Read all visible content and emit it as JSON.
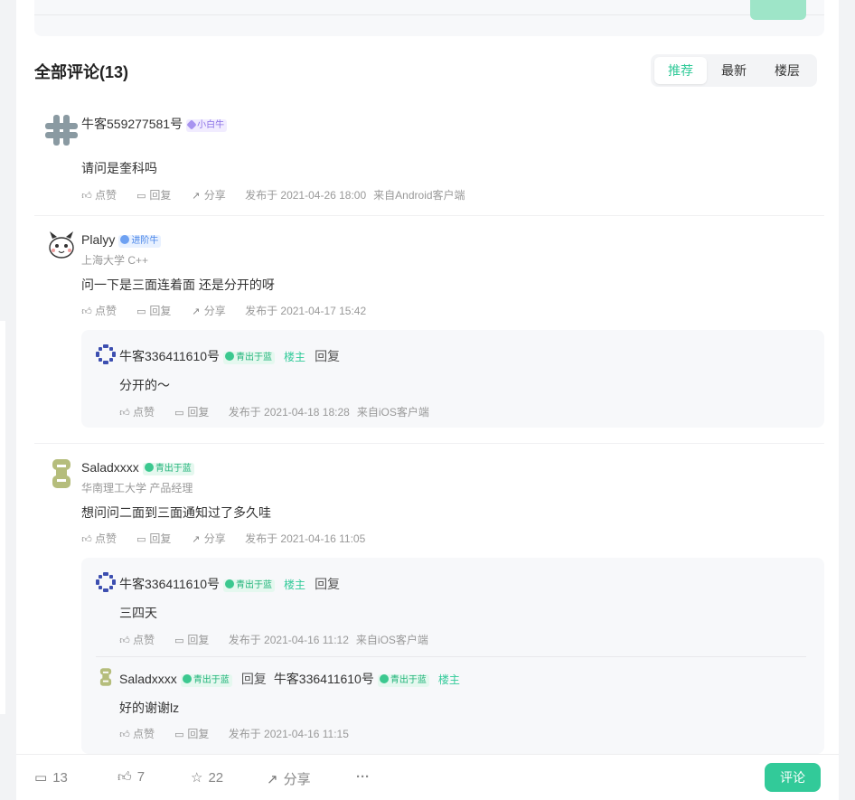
{
  "header": {
    "title": "全部评论(13)"
  },
  "tabs": [
    {
      "label": "推荐"
    },
    {
      "label": "最新"
    },
    {
      "label": "楼层"
    }
  ],
  "actions": {
    "like": "点赞",
    "reply": "回复",
    "share": "分享"
  },
  "comments": [
    {
      "username": "牛客559277581号",
      "badge": "小白牛",
      "sub": "",
      "content": "请问是奎科吗",
      "time": "发布于 2021-04-26 18:00",
      "source": "来自Android客户端"
    },
    {
      "username": "Plalyy",
      "badge": "进阶牛",
      "sub": "上海大学 C++",
      "content": "问一下是三面连着面 还是分开的呀",
      "time": "发布于 2021-04-17 15:42",
      "source": ""
    },
    {
      "username": "Saladxxxx",
      "badge": "青出于蓝",
      "sub": "华南理工大学 产品经理",
      "content": "想问问二面到三面通知过了多久哇",
      "time": "发布于 2021-04-16 11:05",
      "source": ""
    }
  ],
  "replies": [
    {
      "username": "牛客336411610号",
      "badge": "青出于蓝",
      "tag": "楼主",
      "reply_label": "回复",
      "content": "分开的～",
      "time": "发布于 2021-04-18 18:28",
      "source": "来自iOS客户端"
    },
    {
      "username": "牛客336411610号",
      "badge": "青出于蓝",
      "tag": "楼主",
      "reply_label": "回复",
      "content": "三四天",
      "time": "发布于 2021-04-16 11:12",
      "source": "来自iOS客户端"
    },
    {
      "username": "Saladxxxx",
      "badge": "青出于蓝",
      "reply_label": "回复",
      "target_username": "牛客336411610号",
      "target_badge": "青出于蓝",
      "target_tag": "楼主",
      "content": "好的谢谢lz",
      "time": "发布于 2021-04-16 11:15",
      "source": ""
    }
  ],
  "bottom_bar": {
    "comments": "13",
    "likes": "7",
    "stars": "22",
    "share": "分享",
    "more": "···",
    "comment_button": "评论"
  },
  "colors": {
    "accent": "#32ca99",
    "purple_badge": "#8a70e6",
    "blue_badge": "#4a86e8",
    "green_badge": "#23b47b"
  },
  "icons": [
    "comment-icon",
    "thumb-up-icon",
    "star-icon",
    "share-icon",
    "more-icon"
  ]
}
